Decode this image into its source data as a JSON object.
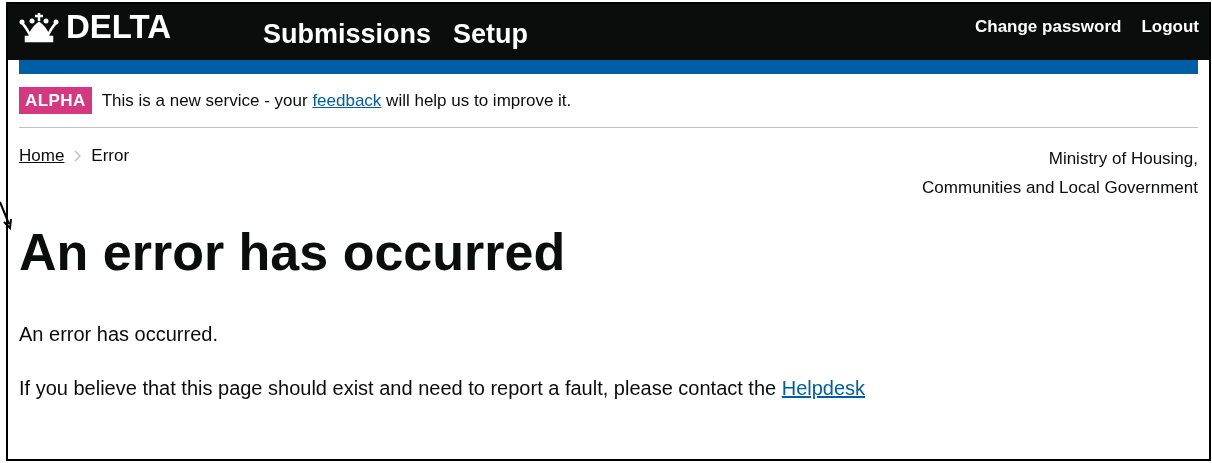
{
  "header": {
    "logo": "DELTA",
    "nav": [
      "Submissions",
      "Setup"
    ],
    "account_links": [
      "Change password",
      "Logout"
    ]
  },
  "phase_banner": {
    "tag": "ALPHA",
    "text_before": "This is a new service - your ",
    "link": "feedback",
    "text_after": " will help us to improve it."
  },
  "breadcrumbs": [
    {
      "label": "Home",
      "link": true
    },
    {
      "label": "Error",
      "link": false
    }
  ],
  "organisation": [
    "Ministry of Housing,",
    "Communities and Local Government"
  ],
  "heading": "An error has occurred",
  "body": {
    "message": "An error has occurred.",
    "contact_before": "If you believe that this page should exist and need to report a fault, please contact the ",
    "contact_link": "Helpdesk"
  }
}
